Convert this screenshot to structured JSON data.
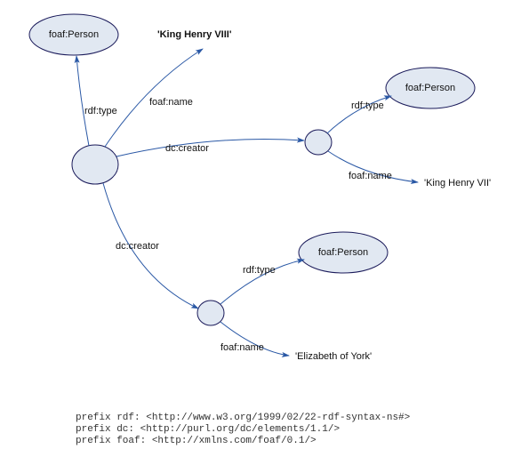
{
  "nodes": {
    "person1": {
      "label": "foaf:Person"
    },
    "person2": {
      "label": "foaf:Person"
    },
    "person3": {
      "label": "foaf:Person"
    }
  },
  "literals": {
    "henry8": "'King Henry VIII'",
    "henry7": "'King Henry VII'",
    "elizabeth": "'Elizabeth of York'"
  },
  "edges": {
    "rdf_type_1": "rdf:type",
    "foaf_name_1": "foaf:name",
    "dc_creator_1": "dc:creator",
    "rdf_type_2": "rdf:type",
    "foaf_name_2": "foaf:name",
    "dc_creator_2": "dc:creator",
    "rdf_type_3": "rdf:type",
    "foaf_name_3": "foaf:name"
  },
  "prefixes": {
    "rdf": "prefix rdf: <http://www.w3.org/1999/02/22-rdf-syntax-ns#>",
    "dc": "prefix dc: <http://purl.org/dc/elements/1.1/>",
    "foaf": "prefix foaf: <http://xmlns.com/foaf/0.1/>"
  },
  "chart_data": {
    "type": "rdf-graph",
    "title": "",
    "nodes": [
      {
        "id": "s1",
        "type": "blank"
      },
      {
        "id": "s2",
        "type": "blank"
      },
      {
        "id": "s3",
        "type": "blank"
      },
      {
        "id": "p1",
        "type": "class",
        "label": "foaf:Person"
      },
      {
        "id": "p2",
        "type": "class",
        "label": "foaf:Person"
      },
      {
        "id": "p3",
        "type": "class",
        "label": "foaf:Person"
      },
      {
        "id": "l1",
        "type": "literal",
        "value": "King Henry VIII"
      },
      {
        "id": "l2",
        "type": "literal",
        "value": "King Henry VII"
      },
      {
        "id": "l3",
        "type": "literal",
        "value": "Elizabeth of York"
      }
    ],
    "edges": [
      {
        "from": "s1",
        "to": "p1",
        "label": "rdf:type"
      },
      {
        "from": "s1",
        "to": "l1",
        "label": "foaf:name"
      },
      {
        "from": "s1",
        "to": "s2",
        "label": "dc:creator"
      },
      {
        "from": "s1",
        "to": "s3",
        "label": "dc:creator"
      },
      {
        "from": "s2",
        "to": "p2",
        "label": "rdf:type"
      },
      {
        "from": "s2",
        "to": "l2",
        "label": "foaf:name"
      },
      {
        "from": "s3",
        "to": "p3",
        "label": "rdf:type"
      },
      {
        "from": "s3",
        "to": "l3",
        "label": "foaf:name"
      }
    ],
    "prefixes": {
      "rdf": "http://www.w3.org/1999/02/22-rdf-syntax-ns#",
      "dc": "http://purl.org/dc/elements/1.1/",
      "foaf": "http://xmlns.com/foaf/0.1/"
    }
  }
}
